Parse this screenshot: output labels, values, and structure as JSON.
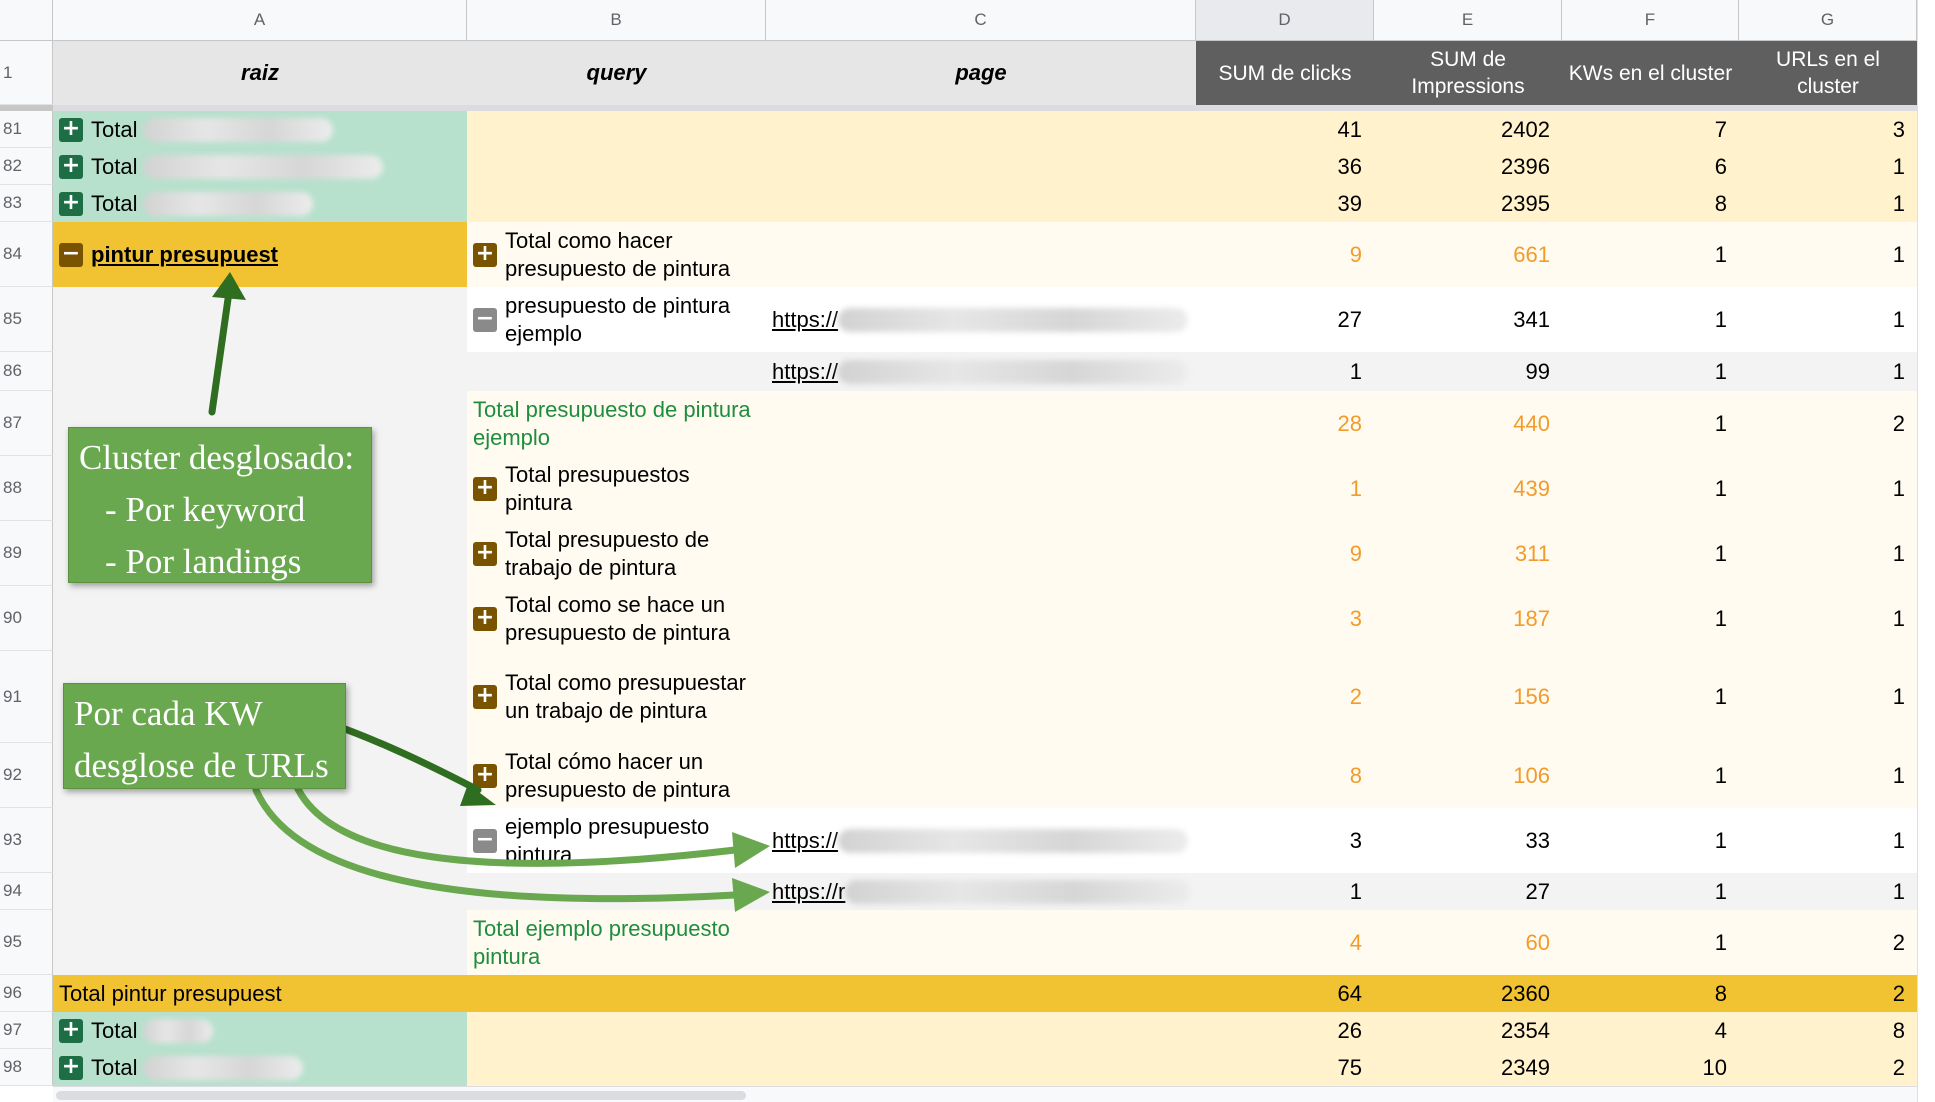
{
  "columns": [
    "A",
    "B",
    "C",
    "D",
    "E",
    "F",
    "G"
  ],
  "row_numbers": [
    "1",
    "81",
    "82",
    "83",
    "84",
    "85",
    "86",
    "87",
    "88",
    "89",
    "90",
    "91",
    "92",
    "93",
    "94",
    "95",
    "96",
    "97",
    "98"
  ],
  "header": {
    "raiz": "raiz",
    "query": "query",
    "page": "page",
    "sum_clicks": "SUM de clicks",
    "sum_impressions": "SUM de Impressions",
    "kws_cluster": "KWs en el cluster",
    "urls_cluster": "URLs en el cluster"
  },
  "rows": {
    "r81": {
      "label": "Total",
      "clicks": "41",
      "impr": "2402",
      "kws": "7",
      "urls": "3"
    },
    "r82": {
      "label": "Total",
      "clicks": "36",
      "impr": "2396",
      "kws": "6",
      "urls": "1"
    },
    "r83": {
      "label": "Total",
      "clicks": "39",
      "impr": "2395",
      "kws": "8",
      "urls": "1"
    },
    "r84": {
      "raiz": "pintur presupuest",
      "query": "Total como hacer presupuesto de pintura",
      "clicks": "9",
      "impr": "661",
      "kws": "1",
      "urls": "1"
    },
    "r85": {
      "query": "presupuesto de pintura ejemplo",
      "page": "https://",
      "clicks": "27",
      "impr": "341",
      "kws": "1",
      "urls": "1"
    },
    "r86": {
      "page": "https://",
      "clicks": "1",
      "impr": "99",
      "kws": "1",
      "urls": "1"
    },
    "r87": {
      "query": "Total presupuesto de pintura ejemplo",
      "clicks": "28",
      "impr": "440",
      "kws": "1",
      "urls": "2"
    },
    "r88": {
      "query": "Total presupuestos pintura",
      "clicks": "1",
      "impr": "439",
      "kws": "1",
      "urls": "1"
    },
    "r89": {
      "query": "Total presupuesto de trabajo de pintura",
      "clicks": "9",
      "impr": "311",
      "kws": "1",
      "urls": "1"
    },
    "r90": {
      "query": "Total como se hace un presupuesto de pintura",
      "clicks": "3",
      "impr": "187",
      "kws": "1",
      "urls": "1"
    },
    "r91": {
      "query": "Total como presupuestar un trabajo de pintura",
      "clicks": "2",
      "impr": "156",
      "kws": "1",
      "urls": "1"
    },
    "r92": {
      "query": "Total cómo hacer un presupuesto de pintura",
      "clicks": "8",
      "impr": "106",
      "kws": "1",
      "urls": "1"
    },
    "r93": {
      "query": "ejemplo presupuesto pintura",
      "page": "https://",
      "clicks": "3",
      "impr": "33",
      "kws": "1",
      "urls": "1"
    },
    "r94": {
      "page": "https://r",
      "clicks": "1",
      "impr": "27",
      "kws": "1",
      "urls": "1"
    },
    "r95": {
      "query": "Total ejemplo presupuesto pintura",
      "clicks": "4",
      "impr": "60",
      "kws": "1",
      "urls": "2"
    },
    "r96": {
      "label": "Total pintur presupuest",
      "clicks": "64",
      "impr": "2360",
      "kws": "8",
      "urls": "2"
    },
    "r97": {
      "label": "Total",
      "clicks": "26",
      "impr": "2354",
      "kws": "4",
      "urls": "8"
    },
    "r98": {
      "label": "Total",
      "clicks": "75",
      "impr": "2349",
      "kws": "10",
      "urls": "2"
    }
  },
  "icons": {
    "expand": "+",
    "collapse": "−"
  },
  "annotations": {
    "cluster_line1": "Cluster desglosado:",
    "cluster_line2": "- Por keyword",
    "cluster_line3": "- Por landings",
    "urls_line1": "Por cada KW",
    "urls_line2": "desglose de URLs"
  },
  "colors": {
    "cluster_yellow": "#f1c232",
    "green_row": "#b7e1cd",
    "light_yellow": "#fff2cc",
    "cream": "#fffbf0",
    "header_dark": "#5f5f5f",
    "callout_green": "#6aa84f",
    "orange_text": "#f29b2b"
  }
}
